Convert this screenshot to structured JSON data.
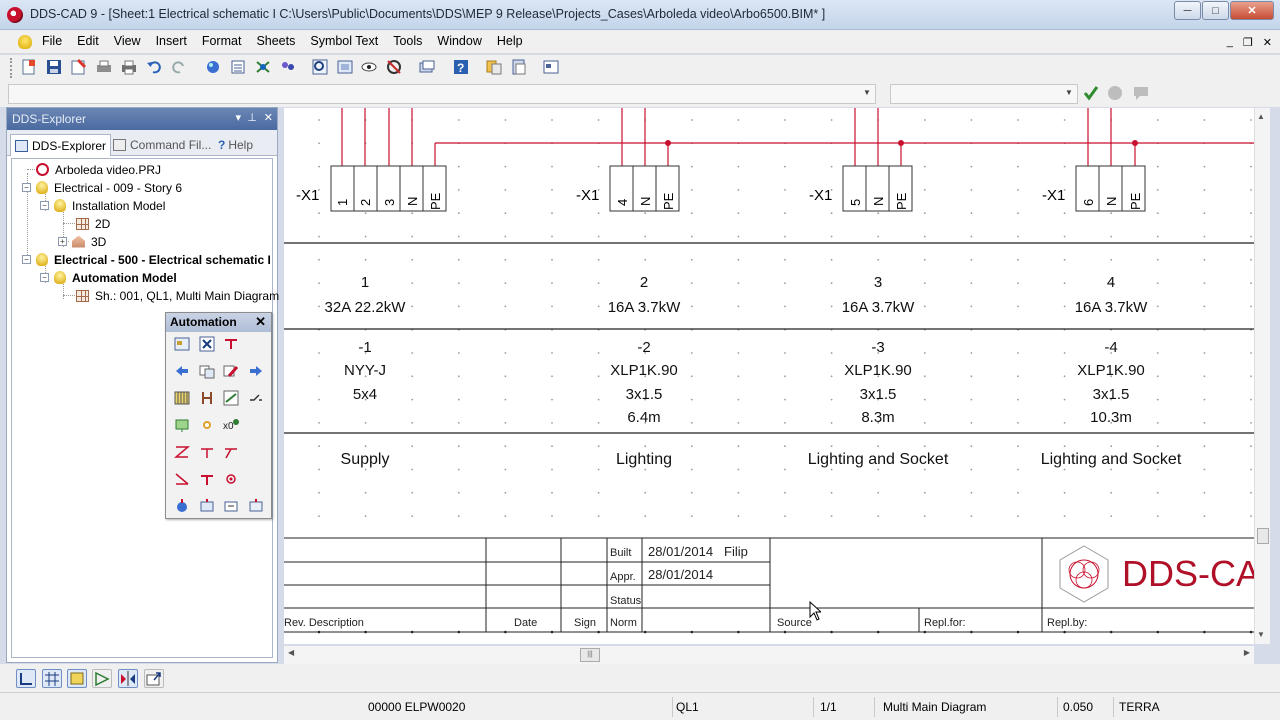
{
  "window": {
    "title": "DDS-CAD 9 - [Sheet:1  Electrical schematic I  C:\\Users\\Public\\Documents\\DDS\\MEP 9 Release\\Projects_Cases\\Arboleda video\\Arbo6500.BIM* ]",
    "minimize": "─",
    "maximize": "□",
    "close": "✕"
  },
  "menu": {
    "items": [
      "File",
      "Edit",
      "View",
      "Insert",
      "Format",
      "Sheets",
      "Symbol Text",
      "Tools",
      "Window",
      "Help"
    ],
    "mdi": [
      "_",
      "❐",
      "✕"
    ]
  },
  "explorer": {
    "title": "DDS-Explorer",
    "controls": [
      "▾",
      "⊥",
      "✕"
    ],
    "tabs": [
      "DDS-Explorer",
      "Command Fil...",
      "Help"
    ],
    "tree": [
      {
        "label": "Arboleda video.PRJ",
        "icon": "project-icon",
        "bold": false
      },
      {
        "label": "Electrical - 009 - Story 6",
        "icon": "bulb-icon",
        "bold": false
      },
      {
        "label": "Installation Model",
        "icon": "bulb-icon",
        "bold": false
      },
      {
        "label": "2D",
        "icon": "grid-icon",
        "bold": false
      },
      {
        "label": "3D",
        "icon": "house-icon",
        "bold": false
      },
      {
        "label": "Electrical - 500 - Electrical schematic I",
        "icon": "bulb-icon",
        "bold": true
      },
      {
        "label": "Automation Model",
        "icon": "bulb-icon",
        "bold": true
      },
      {
        "label": "Sh.: 001, QL1, Multi Main Diagram",
        "icon": "grid-icon",
        "bold": false
      }
    ]
  },
  "automation": {
    "title": "Automation",
    "close": "✕"
  },
  "schematic": {
    "circuits": [
      {
        "terminal": "-X1",
        "pins": [
          "1",
          "2",
          "3",
          "N",
          "PE"
        ],
        "number": "1",
        "rating": "32A   22.2kW",
        "cable_id": "-1",
        "cable_type": "NYY-J",
        "cable_size": "5x4",
        "length": "",
        "description": "Supply"
      },
      {
        "terminal": "-X1",
        "pins": [
          "4",
          "N",
          "PE"
        ],
        "number": "2",
        "rating": "16A   3.7kW",
        "cable_id": "-2",
        "cable_type": "XLP1K.90",
        "cable_size": "3x1.5",
        "length": "6.4m",
        "description": "Lighting"
      },
      {
        "terminal": "-X1",
        "pins": [
          "5",
          "N",
          "PE"
        ],
        "number": "3",
        "rating": "16A   3.7kW",
        "cable_id": "-3",
        "cable_type": "XLP1K.90",
        "cable_size": "3x1.5",
        "length": "8.3m",
        "description": "Lighting and Socket"
      },
      {
        "terminal": "-X1",
        "pins": [
          "6",
          "N",
          "PE"
        ],
        "number": "4",
        "rating": "16A   3.7kW",
        "cable_id": "-4",
        "cable_type": "XLP1K.90",
        "cable_size": "3x1.5",
        "length": "10.3m",
        "description": "Lighting and Socket"
      }
    ],
    "title_block": {
      "built_label": "Built",
      "built_date": "28/01/2014",
      "built_by": "Filip",
      "appr_label": "Appr.",
      "appr_date": "28/01/2014",
      "status_label": "Status",
      "rev_desc_label": "Rev. Description",
      "date_label": "Date",
      "sign_label": "Sign",
      "norm_label": "Norm",
      "source_label": "Source",
      "repl_for_label": "Repl.for:",
      "repl_by_label": "Repl.by:",
      "logo_text": "DDS-CAD"
    }
  },
  "status": {
    "code": "00000 ELPW0020",
    "board": "QL1",
    "page": "1/1",
    "diagram": "Multi Main Diagram",
    "scale": "0.050",
    "layer": "TERRA"
  },
  "colors": {
    "wire": "#c8102e",
    "panel_header": "#5676aa"
  }
}
